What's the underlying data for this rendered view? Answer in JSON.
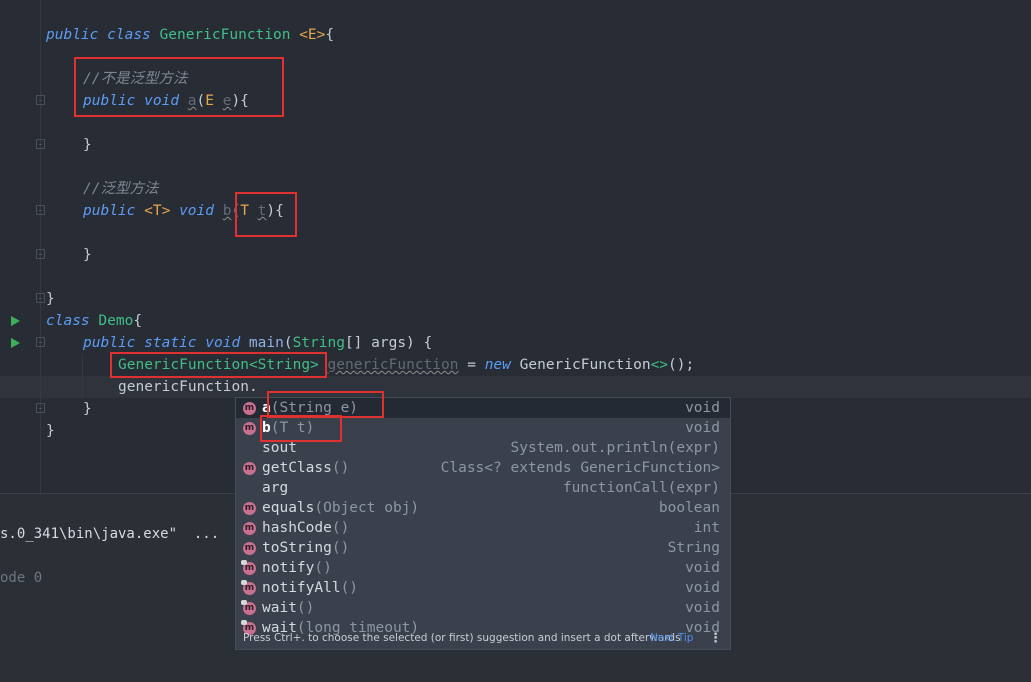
{
  "code": {
    "line1": {
      "kw1": "public",
      "kw2": "class",
      "cls": "GenericFunction",
      "tp": "<E>",
      "rest": "{"
    },
    "line2": {
      "comment": "//不是泛型方法"
    },
    "line3": {
      "kw1": "public",
      "kw2": "void",
      "name": "a",
      "p1": "(",
      "tp": "E",
      "param": "e",
      "rest": "){"
    },
    "line4": {
      "text": "}"
    },
    "line5": {
      "comment": "//泛型方法"
    },
    "line6": {
      "kw1": "public",
      "tp": "<T>",
      "kw2": "void",
      "name": "b",
      "p1": "(",
      "tp2": "T",
      "param": "t",
      "rest": "){"
    },
    "line7": {
      "text": "}"
    },
    "line8": {
      "text": "}"
    },
    "line9": {
      "kw": "class",
      "cls": "Demo",
      "rest": "{"
    },
    "line10": {
      "kw1": "public",
      "kw2": "static",
      "kw3": "void",
      "name": "main",
      "p1": "(",
      "type": "String",
      "rest": "[] args) {"
    },
    "line11": {
      "generic": "GenericFunction<String>",
      "var": "genericFunction",
      "eq": " = ",
      "kw": "new",
      "ctor": "GenericFunction",
      "diamond": "<>",
      "rest": "();"
    },
    "line12": {
      "text": "genericFunction."
    },
    "line13": {
      "text": "}"
    },
    "line14": {
      "text": "}"
    }
  },
  "console": {
    "line1": "s.0_341\\bin\\java.exe\"  ...",
    "line2": "ode 0"
  },
  "completion": {
    "items": [
      {
        "icon": "m",
        "name": "a",
        "params": "(String e)",
        "ret": "void"
      },
      {
        "icon": "m",
        "name": "b",
        "params": "(T t)",
        "ret": "void"
      },
      {
        "icon": "",
        "name": "sout",
        "params": "",
        "ret": "System.out.println(expr)"
      },
      {
        "icon": "m",
        "name": "getClass",
        "params": "()",
        "ret": "Class<? extends GenericFunction>"
      },
      {
        "icon": "",
        "name": "arg",
        "params": "",
        "ret": "functionCall(expr)"
      },
      {
        "icon": "m",
        "name": "equals",
        "params": "(Object obj)",
        "ret": "boolean"
      },
      {
        "icon": "m",
        "name": "hashCode",
        "params": "()",
        "ret": "int"
      },
      {
        "icon": "m",
        "name": "toString",
        "params": "()",
        "ret": "String"
      },
      {
        "icon": "m",
        "name": "notify",
        "params": "()",
        "ret": "void"
      },
      {
        "icon": "m",
        "name": "notifyAll",
        "params": "()",
        "ret": "void"
      },
      {
        "icon": "m",
        "name": "wait",
        "params": "()",
        "ret": "void"
      },
      {
        "icon": "m",
        "name": "wait",
        "params": "(long timeout)",
        "ret": "void"
      }
    ],
    "footer": {
      "hint": "Press Ctrl+. to choose the selected (or first) suggestion and insert a dot afterwards",
      "tip": "Next Tip",
      "more": "⋮"
    }
  },
  "colors": {
    "highlight_box": "#e03131",
    "run_arrow": "#3fae5a",
    "method_icon": "#c9708f"
  }
}
